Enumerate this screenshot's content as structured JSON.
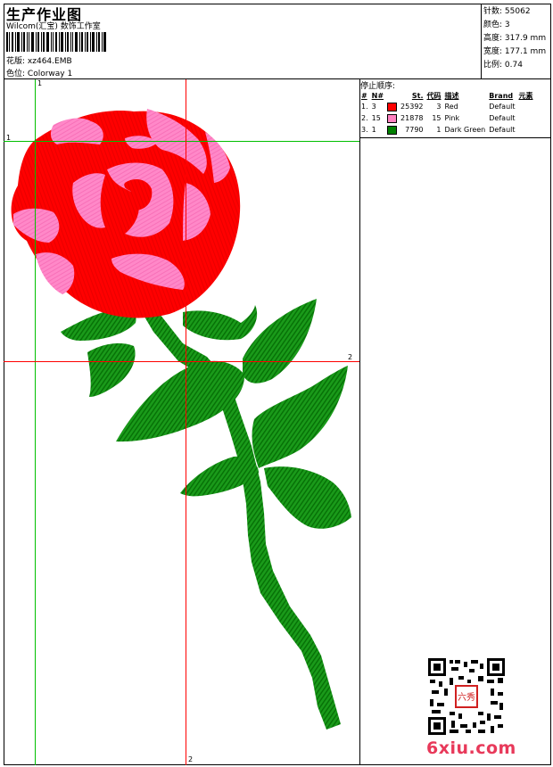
{
  "header": {
    "title": "生产作业图",
    "company": "Wilcom(汇宝) 数饰工作室",
    "design_label": "花版:",
    "design_value": "xz464.EMB",
    "color_label": "色位:",
    "color_value": "Colorway 1"
  },
  "stats": [
    {
      "label": "针数:",
      "value": "55062"
    },
    {
      "label": "颜色:",
      "value": "3"
    },
    {
      "label": "高度:",
      "value": "317.9 mm"
    },
    {
      "label": "宽度:",
      "value": "177.1 mm"
    },
    {
      "label": "比例:",
      "value": "0.74"
    }
  ],
  "stop_sequence": {
    "title": "停止顺序:",
    "columns": [
      "#",
      "N#",
      "St.",
      "代码",
      "描述",
      "Brand",
      "元素"
    ],
    "rows": [
      {
        "index": "1.",
        "needle": "3",
        "color": "#ff0000",
        "stitches": "25392",
        "code": "3",
        "description": "Red",
        "brand": "Default"
      },
      {
        "index": "2.",
        "needle": "15",
        "color": "#ff80c0",
        "stitches": "21878",
        "code": "15",
        "description": "Pink",
        "brand": "Default"
      },
      {
        "index": "3.",
        "needle": "1",
        "color": "#008000",
        "stitches": "7790",
        "code": "1",
        "description": "Dark Green",
        "brand": "Default"
      }
    ]
  },
  "guides": {
    "v1_label": "1",
    "h1_label": "1",
    "v2_label": "2",
    "h2_label": "2",
    "green": "#00c000",
    "red": "#ff0000"
  },
  "watermark": {
    "site": "6xiu.com",
    "seal_text": "六秀"
  }
}
